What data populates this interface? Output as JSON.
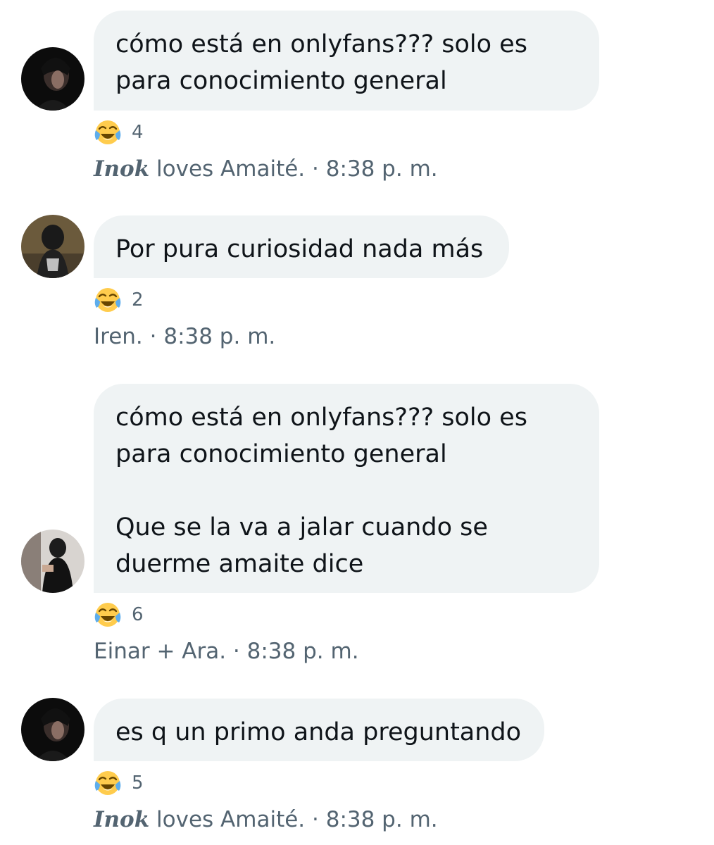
{
  "messages": [
    {
      "text": "cómo está en onlyfans??? solo es\npara conocimiento general",
      "reaction_emoji": "face-with-tears-of-joy-icon",
      "reaction_count": "4",
      "sender_fancy": "Inok",
      "sender_rest": " loves Amaité.",
      "separator": " · ",
      "time": "8:38 p. m."
    },
    {
      "text": "Por pura curiosidad nada más",
      "reaction_emoji": "face-with-tears-of-joy-icon",
      "reaction_count": "2",
      "sender_fancy": "",
      "sender_rest": "Iren.",
      "separator": " · ",
      "time": "8:38 p. m."
    },
    {
      "text": "cómo está en onlyfans??? solo es\npara conocimiento general\n\nQue se la va a jalar cuando se\nduerme amaite dice",
      "reaction_emoji": "face-with-tears-of-joy-icon",
      "reaction_count": "6",
      "sender_fancy": "",
      "sender_rest": "Einar + Ara.",
      "separator": " · ",
      "time": "8:38 p. m."
    },
    {
      "text": "es q un primo anda preguntando",
      "reaction_emoji": "face-with-tears-of-joy-icon",
      "reaction_count": "5",
      "sender_fancy": "Inok",
      "sender_rest": " loves Amaité.",
      "separator": " · ",
      "time": "8:38 p. m."
    }
  ],
  "colors": {
    "bubble": "#eff3f4",
    "text": "#0f1419",
    "meta": "#536471"
  }
}
